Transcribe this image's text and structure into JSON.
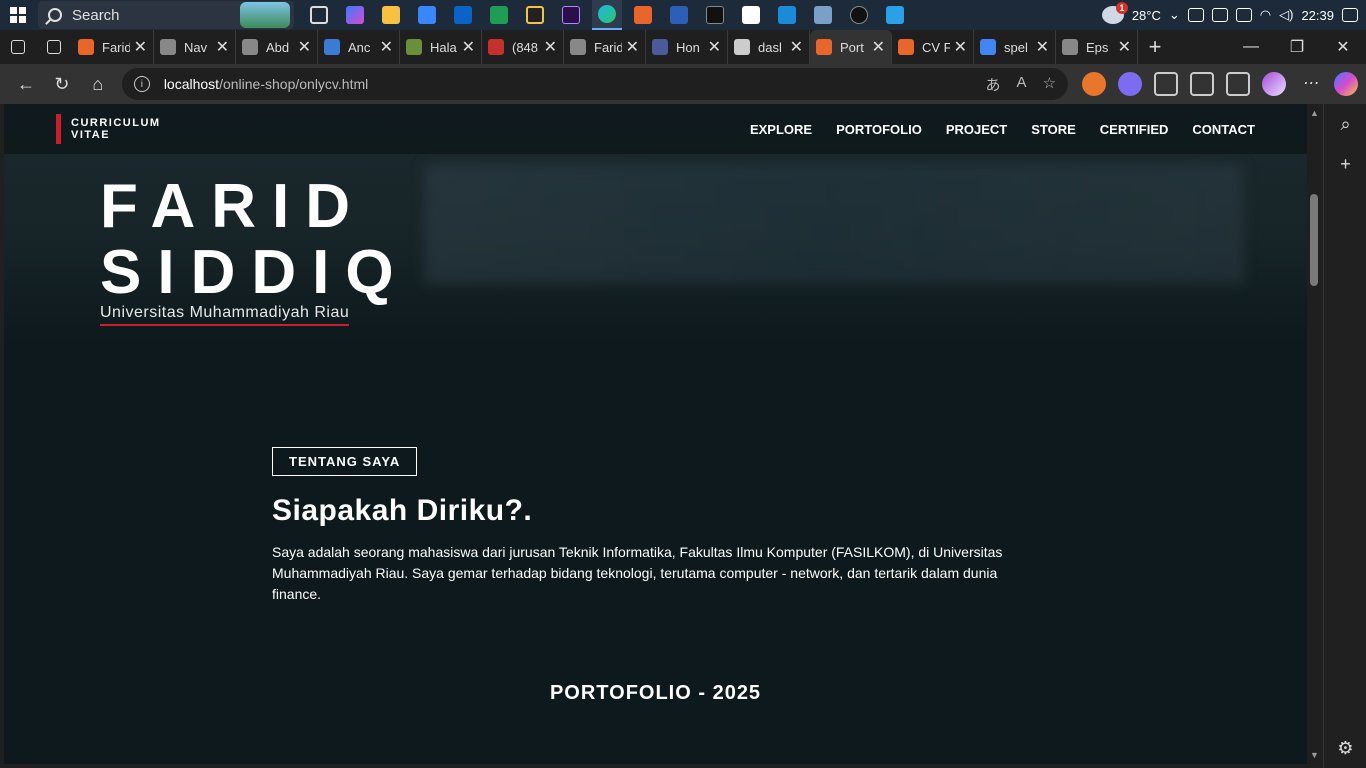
{
  "taskbar": {
    "search_placeholder": "Search",
    "temperature": "28°C",
    "time": "22:39",
    "weather_badge": "1"
  },
  "tabs": [
    {
      "label": "Farid",
      "color": "#e8652b"
    },
    {
      "label": "Nav",
      "color": "#888888"
    },
    {
      "label": "Abd",
      "color": "#888888"
    },
    {
      "label": "Anc",
      "color": "#3a7bd5"
    },
    {
      "label": "Hala",
      "color": "#6a8f3a"
    },
    {
      "label": "(848",
      "color": "#c4302b"
    },
    {
      "label": "Farid",
      "color": "#888888"
    },
    {
      "label": "Hon",
      "color": "#4a5a9a"
    },
    {
      "label": "dasl",
      "color": "#cccccc"
    },
    {
      "label": "Port",
      "color": "#e8652b",
      "active": true
    },
    {
      "label": "CV F",
      "color": "#e8652b"
    },
    {
      "label": "spel",
      "color": "#4285f4"
    },
    {
      "label": "Eps",
      "color": "#888888"
    }
  ],
  "address": {
    "host": "localhost",
    "path": "/online-shop/onlycv.html"
  },
  "site": {
    "brand_line1": "CURRICULUM",
    "brand_line2": "VITAE",
    "menu": [
      "EXPLORE",
      "PORTOFOLIO",
      "PROJECT",
      "STORE",
      "CERTIFIED",
      "CONTACT"
    ],
    "name_line1": "FARID",
    "name_line2": "SIDDIQ",
    "university": "Universitas Muhammadiyah Riau",
    "about_tag": "TENTANG SAYA",
    "about_title": "Siapakah Diriku?.",
    "about_text": "Saya adalah seorang mahasiswa dari jurusan Teknik Informatika, Fakultas Ilmu Komputer (FASILKOM), di Universitas Muhammadiyah Riau. Saya gemar terhadap bidang teknologi, terutama computer - network, dan tertarik dalam dunia finance.",
    "portfolio_heading": "PORTOFOLIO - 2025",
    "accent_color": "#c8202a"
  }
}
